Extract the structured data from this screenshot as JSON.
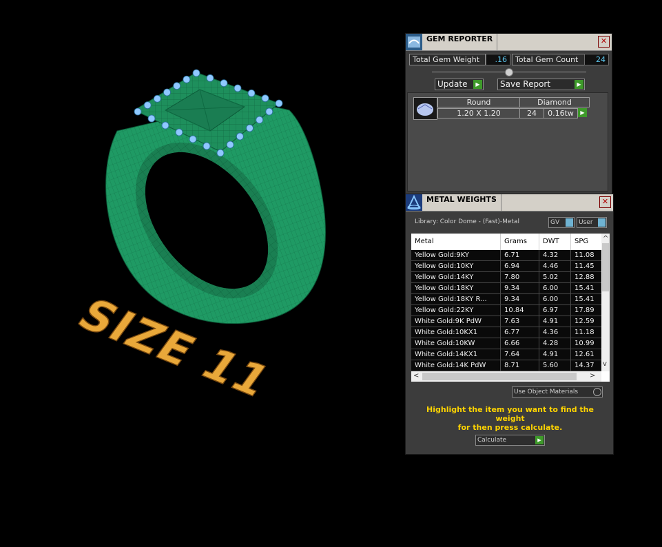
{
  "viewport": {
    "engraving_text": "SIZE 11",
    "ring_color": "#21a06a",
    "gem_color": "#8fc8ff",
    "engraving_color": "#e9a83a"
  },
  "gem_reporter": {
    "title": "GEM REPORTER",
    "close_symbol": "✕",
    "total_weight_label": "Total Gem Weight",
    "total_weight_value": ".16",
    "total_count_label": "Total Gem Count",
    "total_count_value": "24",
    "update_label": "Update",
    "save_report_label": "Save Report",
    "go_symbol": "▶",
    "columns": [
      "Round",
      "Diamond"
    ],
    "gem": {
      "size": "1.20 X 1.20",
      "count": "24",
      "weight": "0.16tw"
    }
  },
  "metal_weights": {
    "title": "METAL WEIGHTS",
    "close_symbol": "✕",
    "library": "Library: Color Dome - (Fast)-Metal",
    "gv_label": "GV",
    "user_label": "User",
    "headers": [
      "Metal",
      "Grams",
      "DWT",
      "SPG"
    ],
    "rows": [
      [
        "Yellow Gold:9KY",
        "6.71",
        "4.32",
        "11.08"
      ],
      [
        "Yellow Gold:10KY",
        "6.94",
        "4.46",
        "11.45"
      ],
      [
        "Yellow Gold:14KY",
        "7.80",
        "5.02",
        "12.88"
      ],
      [
        "Yellow Gold:18KY",
        "9.34",
        "6.00",
        "15.41"
      ],
      [
        "Yellow Gold:18KY R...",
        "9.34",
        "6.00",
        "15.41"
      ],
      [
        "Yellow Gold:22KY",
        "10.84",
        "6.97",
        "17.89"
      ],
      [
        "White Gold:9K PdW",
        "7.63",
        "4.91",
        "12.59"
      ],
      [
        "White Gold:10KX1",
        "6.77",
        "4.36",
        "11.18"
      ],
      [
        "White Gold:10KW",
        "6.66",
        "4.28",
        "10.99"
      ],
      [
        "White Gold:14KX1",
        "7.64",
        "4.91",
        "12.61"
      ],
      [
        "White Gold:14K PdW",
        "8.71",
        "5.60",
        "14.37"
      ]
    ],
    "use_object_materials_label": "Use Object Materials",
    "hint_line1": "Highlight the item you want to find the weight",
    "hint_line2": "for then press calculate.",
    "calculate_label": "Calculate",
    "go_symbol": "▶",
    "scroll_up": "^",
    "scroll_down": "v",
    "scroll_left": "<",
    "scroll_right": ">"
  }
}
